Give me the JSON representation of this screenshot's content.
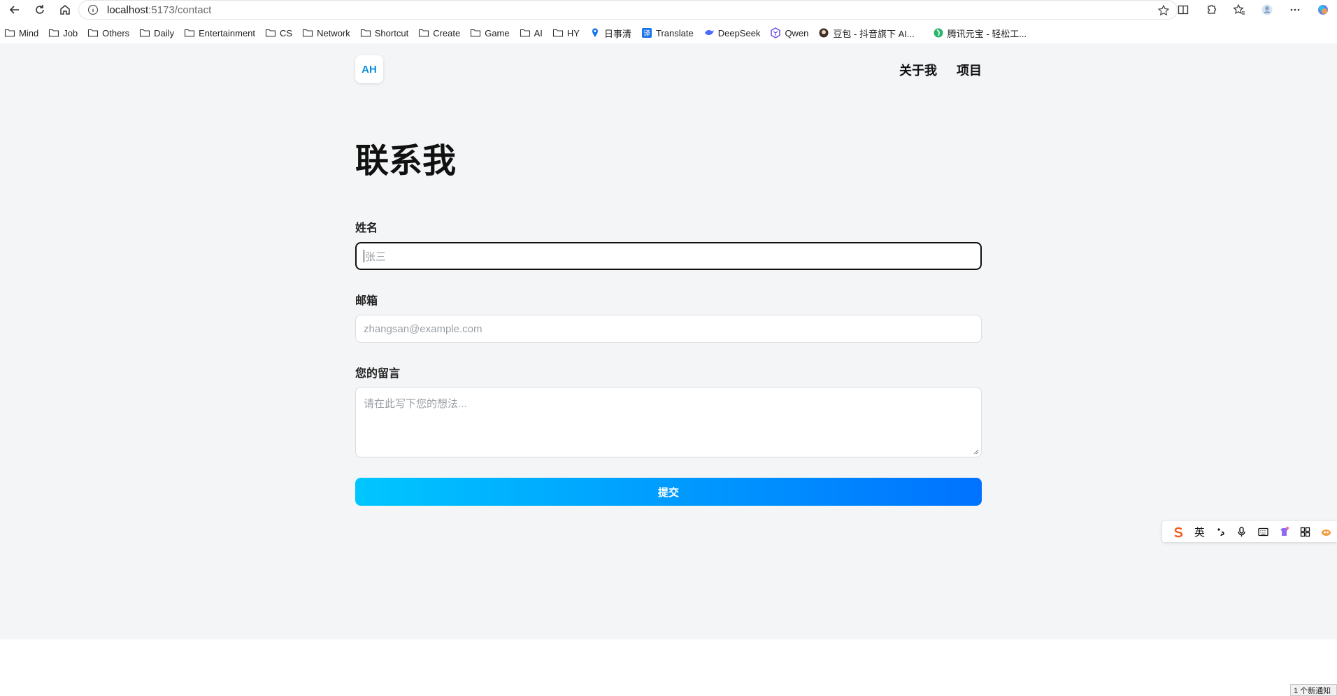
{
  "browser": {
    "url_host": "localhost",
    "url_path": ":5173/contact"
  },
  "bookmarks": [
    {
      "label": "Mind",
      "icon": "folder-icon"
    },
    {
      "label": "Job",
      "icon": "folder-icon"
    },
    {
      "label": "Others",
      "icon": "folder-icon"
    },
    {
      "label": "Daily",
      "icon": "folder-icon"
    },
    {
      "label": "Entertainment",
      "icon": "folder-icon"
    },
    {
      "label": "CS",
      "icon": "folder-icon"
    },
    {
      "label": "Network",
      "icon": "folder-icon"
    },
    {
      "label": "Shortcut",
      "icon": "folder-icon"
    },
    {
      "label": "Create",
      "icon": "folder-icon"
    },
    {
      "label": "Game",
      "icon": "folder-icon"
    },
    {
      "label": "AI",
      "icon": "folder-icon"
    },
    {
      "label": "HY",
      "icon": "folder-icon"
    },
    {
      "label": "日事清",
      "icon": "pin-icon"
    },
    {
      "label": "Translate",
      "icon": "translate-icon"
    },
    {
      "label": "DeepSeek",
      "icon": "deepseek-icon"
    },
    {
      "label": "Qwen",
      "icon": "qwen-icon"
    },
    {
      "label": "豆包 - 抖音旗下 AI...",
      "icon": "doubao-icon"
    },
    {
      "label": "腾讯元宝 - 轻松工...",
      "icon": "yuanbao-icon"
    }
  ],
  "header": {
    "logo": "AH",
    "nav": [
      "关于我",
      "项目"
    ]
  },
  "main": {
    "title": "联系我",
    "name_label": "姓名",
    "name_placeholder": "张三",
    "email_label": "邮箱",
    "email_placeholder": "zhangsan@example.com",
    "message_label": "您的留言",
    "message_placeholder": "请在此写下您的想法...",
    "submit_label": "提交"
  },
  "ime": {
    "lang": "英"
  },
  "notification": "1 个新通知",
  "colors": {
    "accent_start": "#00c6ff",
    "accent_end": "#0072ff",
    "page_bg": "#f4f5f7",
    "logo_text": "#0a8fe0"
  }
}
